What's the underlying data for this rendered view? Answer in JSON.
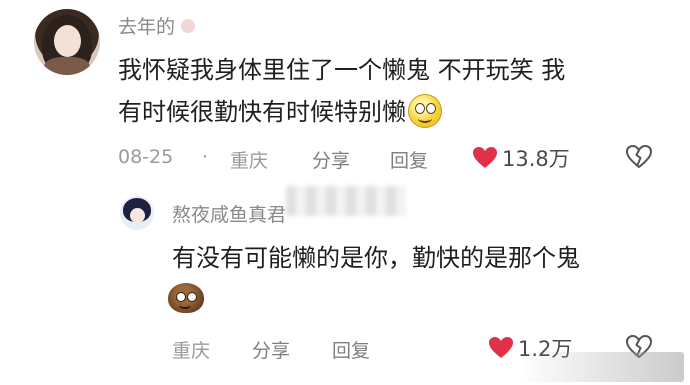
{
  "comment": {
    "username": "去年的",
    "text_line1": "我怀疑我身体里住了一个懒鬼 不开玩笑 我",
    "text_line2": "有时候很勤快有时候特别懒",
    "emoji": "smiling-face-emoji",
    "time": "08-25",
    "dot": "·",
    "location": "重庆",
    "share_label": "分享",
    "reply_label": "回复",
    "likes": "13.8万"
  },
  "reply": {
    "username": "熬夜咸鱼真君",
    "text_line1": "有没有可能懒的是你，勤快的是那个鬼",
    "emoji": "brown-face-emoji",
    "location": "重庆",
    "share_label": "分享",
    "reply_label": "回复",
    "likes": "1.2万"
  },
  "colors": {
    "like_heart": "#e0304a",
    "meta_text": "#9a9a9a",
    "username": "#8a8a8a",
    "body_text": "#1f1f1f"
  },
  "icons": {
    "like": "heart-icon",
    "dislike": "broken-heart-icon"
  }
}
